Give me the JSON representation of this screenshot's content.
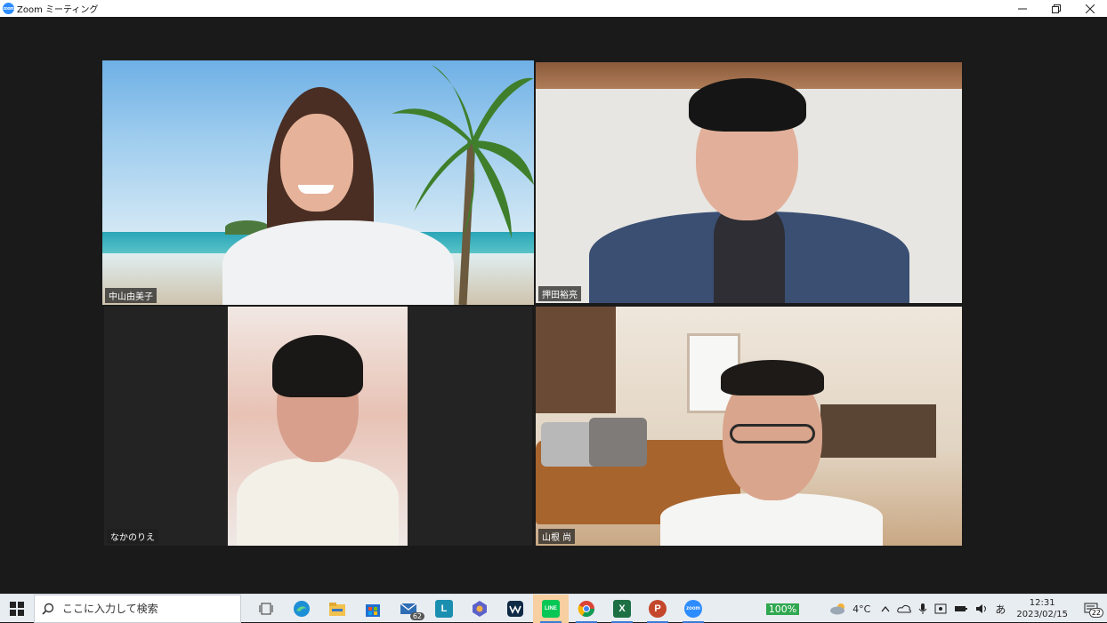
{
  "window": {
    "title": "Zoom ミーティング",
    "logo_text": "zoom"
  },
  "participants": [
    {
      "name": "中山由美子",
      "active_speaker": true,
      "background": "beach"
    },
    {
      "name": "押田裕亮",
      "active_speaker": false,
      "background": "wall"
    },
    {
      "name": "なかのりえ",
      "active_speaker": false,
      "background": "snow"
    },
    {
      "name": "山根 尚",
      "active_speaker": false,
      "background": "living-room"
    }
  ],
  "taskbar": {
    "search_placeholder": "ここに入力して検索",
    "icons": [
      {
        "name": "task-view-icon"
      },
      {
        "name": "edge-icon"
      },
      {
        "name": "file-explorer-icon"
      },
      {
        "name": "store-icon"
      },
      {
        "name": "mail-icon",
        "badge": "62"
      },
      {
        "name": "l-app-icon",
        "label": "L"
      },
      {
        "name": "teams-icon"
      },
      {
        "name": "webex-icon"
      },
      {
        "name": "line-icon",
        "label": "LINE"
      },
      {
        "name": "chrome-icon"
      },
      {
        "name": "excel-icon",
        "label": "X"
      },
      {
        "name": "powerpoint-icon",
        "label": "P"
      },
      {
        "name": "zoom-icon",
        "label": "zoom"
      }
    ],
    "battery": "100%",
    "temperature": "4°C",
    "ime": "あ",
    "time": "12:31",
    "date": "2023/02/15",
    "notification_count": "22"
  }
}
